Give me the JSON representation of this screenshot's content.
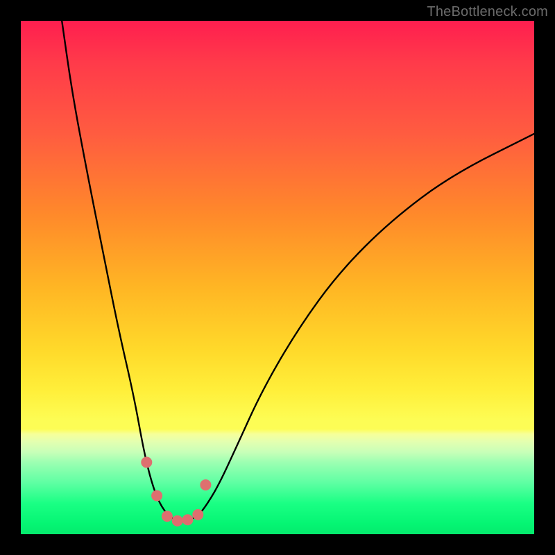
{
  "watermark": "TheBottleneck.com",
  "chart_data": {
    "type": "line",
    "title": "",
    "xlabel": "",
    "ylabel": "",
    "xlim": [
      0,
      100
    ],
    "ylim": [
      0,
      100
    ],
    "grid": false,
    "series": [
      {
        "name": "bottleneck-curve",
        "color": "#000000",
        "x": [
          8,
          10,
          13,
          16,
          19,
          22,
          24,
          25.5,
          27,
          29,
          31,
          33,
          34.5,
          36,
          38.5,
          42,
          47,
          54,
          62,
          72,
          84,
          100
        ],
        "values": [
          100,
          86,
          70,
          55,
          40,
          27,
          16,
          10,
          6,
          3.2,
          2.6,
          2.8,
          3.6,
          5.4,
          9.5,
          17,
          28,
          40,
          51,
          61,
          70,
          78
        ]
      },
      {
        "name": "bottleneck-markers",
        "color": "#de6f6f",
        "x": [
          24.5,
          26.5,
          28.5,
          30.5,
          32.5,
          34.5,
          36.0
        ],
        "values": [
          14.0,
          7.5,
          3.5,
          2.6,
          2.8,
          3.8,
          9.6
        ]
      }
    ]
  }
}
